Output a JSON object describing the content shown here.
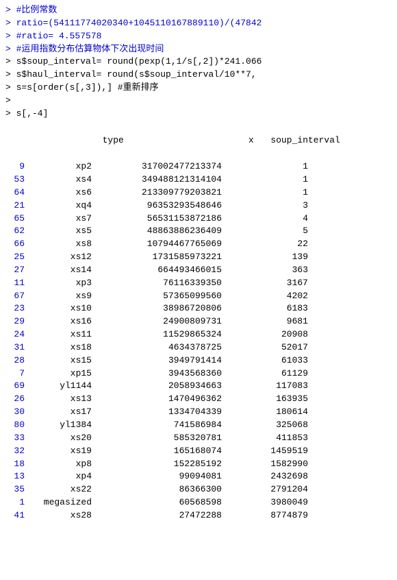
{
  "console": {
    "lines": [
      {
        "type": "comment",
        "content": "> #比例常数"
      },
      {
        "type": "prompt_code",
        "content": "> ratio=(54111774020340+1045110167889110)/(47842"
      },
      {
        "type": "prompt_result",
        "content": "> #ratio= 4.557578"
      },
      {
        "type": "comment",
        "content": "> #运用指数分布估算物体下次出现时间"
      },
      {
        "type": "prompt_code",
        "content": "> s$soup_interval= round(pexp(1,1/s[,2])*241.066"
      },
      {
        "type": "prompt_code",
        "content": "> s$haul_interval= round(s$soup_interval/10**7,"
      },
      {
        "type": "prompt_code",
        "content": "> s=s[order(s[,3]),]  #重新排序"
      },
      {
        "type": "prompt_empty",
        "content": ">"
      },
      {
        "type": "prompt_code",
        "content": "> s[,-4]"
      }
    ],
    "table": {
      "headers": [
        "",
        "type",
        "x",
        "soup_interval"
      ],
      "rows": [
        {
          "rownum": "9",
          "type": "xp2",
          "x": "317002477213374",
          "soup": "1"
        },
        {
          "rownum": "53",
          "type": "xs4",
          "x": "349488121314104",
          "soup": "1"
        },
        {
          "rownum": "64",
          "type": "xs6",
          "x": "213309779203821",
          "soup": "1"
        },
        {
          "rownum": "21",
          "type": "xq4",
          "x": "96353293548646",
          "soup": "3"
        },
        {
          "rownum": "65",
          "type": "xs7",
          "x": "56531153872186",
          "soup": "4"
        },
        {
          "rownum": "62",
          "type": "xs5",
          "x": "48863886236409",
          "soup": "5"
        },
        {
          "rownum": "66",
          "type": "xs8",
          "x": "10794467765069",
          "soup": "22"
        },
        {
          "rownum": "25",
          "type": "xs12",
          "x": "1731585973221",
          "soup": "139"
        },
        {
          "rownum": "27",
          "type": "xs14",
          "x": "664493466015",
          "soup": "363"
        },
        {
          "rownum": "11",
          "type": "xp3",
          "x": "76116339350",
          "soup": "3167"
        },
        {
          "rownum": "67",
          "type": "xs9",
          "x": "57365099560",
          "soup": "4202"
        },
        {
          "rownum": "23",
          "type": "xs10",
          "x": "38986720806",
          "soup": "6183"
        },
        {
          "rownum": "29",
          "type": "xs16",
          "x": "24900809731",
          "soup": "9681"
        },
        {
          "rownum": "24",
          "type": "xs11",
          "x": "11529865324",
          "soup": "20908"
        },
        {
          "rownum": "31",
          "type": "xs18",
          "x": "4634378725",
          "soup": "52017"
        },
        {
          "rownum": "28",
          "type": "xs15",
          "x": "3949791414",
          "soup": "61033"
        },
        {
          "rownum": "7",
          "type": "xp15",
          "x": "3943568360",
          "soup": "61129"
        },
        {
          "rownum": "69",
          "type": "yl1144",
          "x": "2058934663",
          "soup": "117083"
        },
        {
          "rownum": "26",
          "type": "xs13",
          "x": "1470496362",
          "soup": "163935"
        },
        {
          "rownum": "30",
          "type": "xs17",
          "x": "1334704339",
          "soup": "180614"
        },
        {
          "rownum": "80",
          "type": "yl1384",
          "x": "741586984",
          "soup": "325068"
        },
        {
          "rownum": "33",
          "type": "xs20",
          "x": "585320781",
          "soup": "411853"
        },
        {
          "rownum": "32",
          "type": "xs19",
          "x": "165168074",
          "soup": "1459519"
        },
        {
          "rownum": "18",
          "type": "xp8",
          "x": "152285192",
          "soup": "1582990"
        },
        {
          "rownum": "13",
          "type": "xp4",
          "x": "99094081",
          "soup": "2432698"
        },
        {
          "rownum": "35",
          "type": "xs22",
          "x": "86366300",
          "soup": "2791204"
        },
        {
          "rownum": "1",
          "type": "megasized",
          "x": "60568598",
          "soup": "3980049"
        },
        {
          "rownum": "41",
          "type": "xs28",
          "x": "27472288",
          "soup": "8774879"
        }
      ]
    }
  }
}
